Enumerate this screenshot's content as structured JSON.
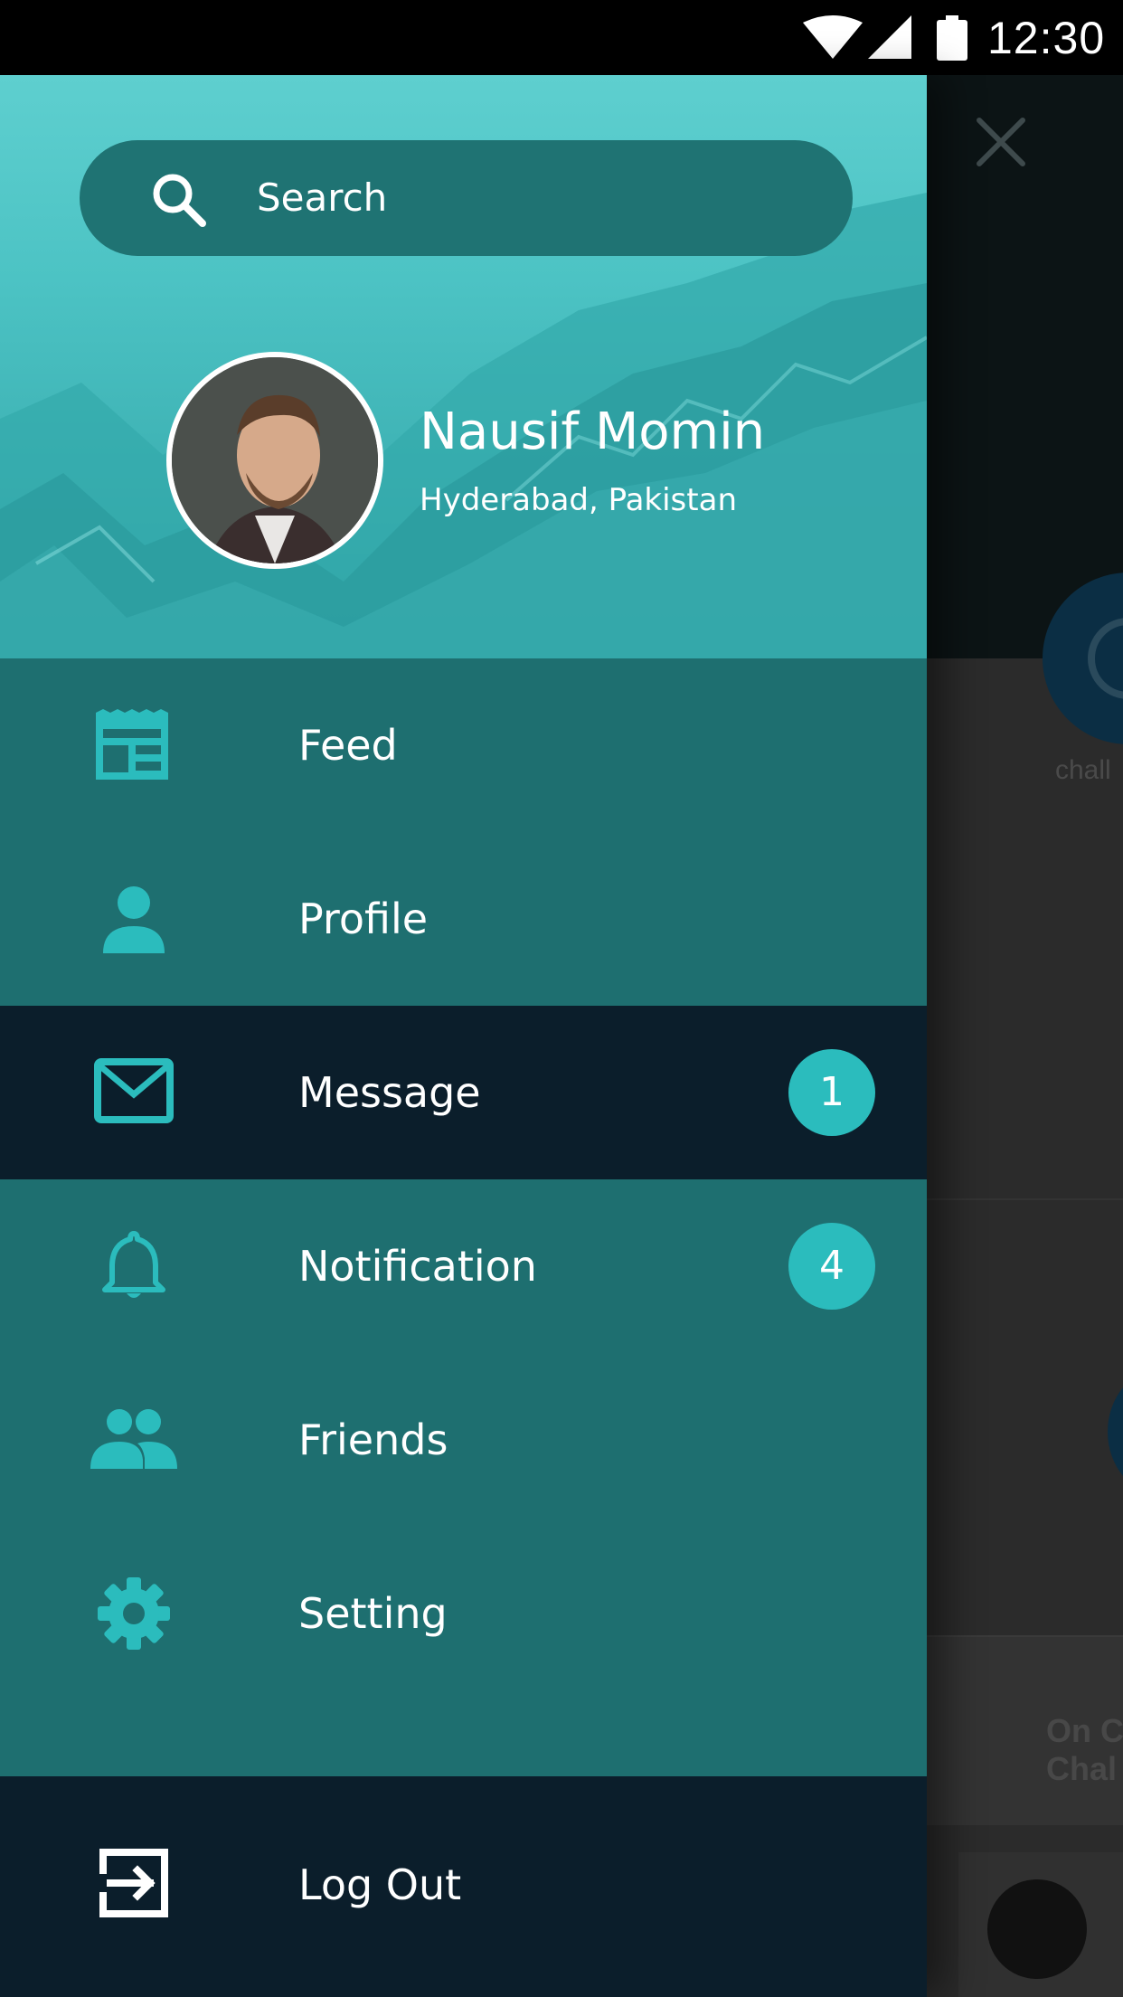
{
  "status_bar": {
    "time": "12:30",
    "icons": [
      "wifi-icon",
      "signal-icon",
      "battery-icon"
    ]
  },
  "background_app": {
    "challenge_label": "chall",
    "card_text_line1": "On C",
    "card_text_line2": "Chal"
  },
  "drawer": {
    "search": {
      "placeholder": "Search"
    },
    "profile": {
      "name": "Nausif Momin",
      "location": "Hyderabad, Pakistan"
    },
    "menu": [
      {
        "label": "Feed",
        "icon": "feed-icon",
        "badge": null,
        "active": false
      },
      {
        "label": "Profile",
        "icon": "person-icon",
        "badge": null,
        "active": false
      },
      {
        "label": "Message",
        "icon": "envelope-icon",
        "badge": "1",
        "active": true
      },
      {
        "label": "Notification",
        "icon": "bell-icon",
        "badge": "4",
        "active": false
      },
      {
        "label": "Friends",
        "icon": "people-icon",
        "badge": null,
        "active": false
      },
      {
        "label": "Setting",
        "icon": "gear-icon",
        "badge": null,
        "active": false
      }
    ],
    "logout": {
      "label": "Log Out",
      "icon": "logout-icon"
    }
  },
  "colors": {
    "accent": "#2bbcbd",
    "drawer_bg": "#1e6f70",
    "active_bg": "#0b1e2b",
    "header_teal": "#4cc3c4"
  }
}
